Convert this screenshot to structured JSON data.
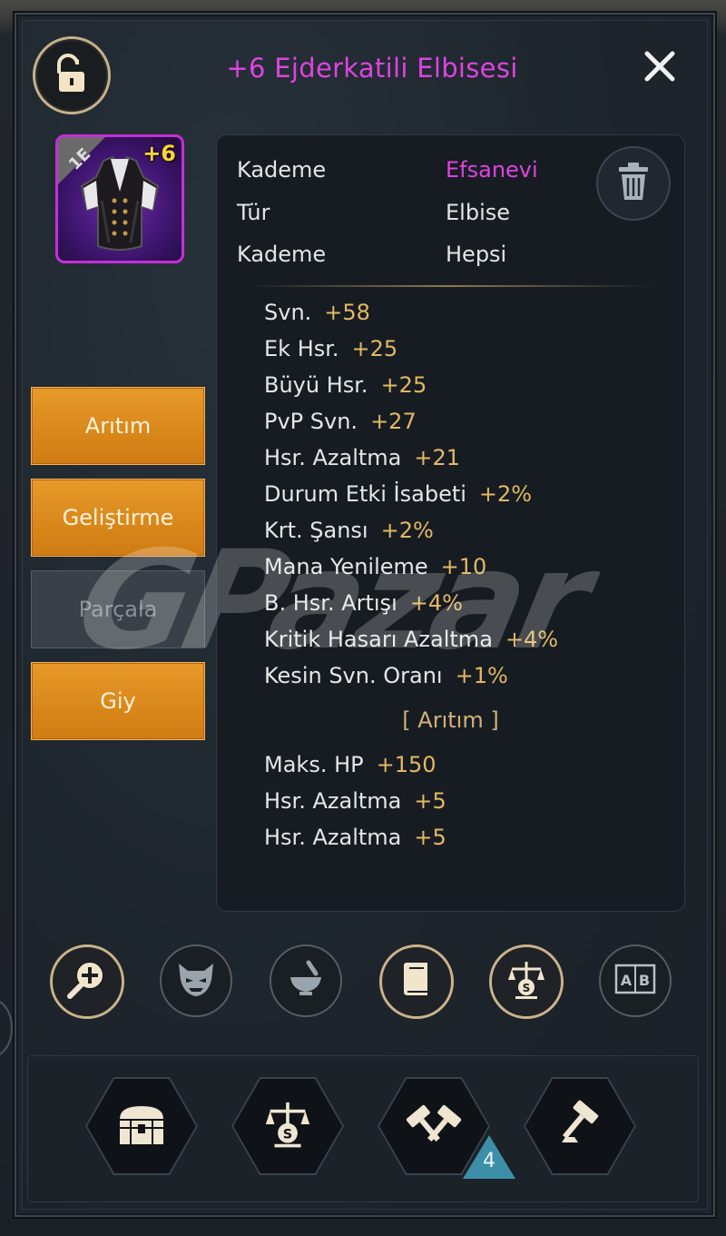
{
  "header": {
    "title": "+6 Ejderkatili Elbisesi"
  },
  "item": {
    "tier_badge": "1E",
    "enhance_level": "+6"
  },
  "side_buttons": {
    "refine": "Arıtım",
    "upgrade": "Geliştirme",
    "dismantle": "Parçala",
    "equip": "Giy"
  },
  "info": {
    "rows": [
      {
        "label": "Kademe",
        "value": "Efsanevi"
      },
      {
        "label": "Tür",
        "value": "Elbise"
      },
      {
        "label": "Kademe",
        "value": "Hepsi"
      }
    ],
    "stats": [
      {
        "name": "Svn.",
        "value": "+58"
      },
      {
        "name": "Ek Hsr.",
        "value": "+25"
      },
      {
        "name": "Büyü Hsr.",
        "value": "+25"
      },
      {
        "name": "PvP Svn.",
        "value": "+27"
      },
      {
        "name": "Hsr. Azaltma",
        "value": "+21"
      },
      {
        "name": "Durum Etki İsabeti",
        "value": "+2%"
      },
      {
        "name": "Krt. Şansı",
        "value": "+2%"
      },
      {
        "name": "Mana Yenileme",
        "value": "+10"
      },
      {
        "name": "B. Hsr. Artışı",
        "value": "+4%"
      },
      {
        "name": "Kritik Hasarı Azaltma",
        "value": "+4%"
      },
      {
        "name": "Kesin Svn. Oranı",
        "value": "+1%"
      }
    ],
    "refine_header": "[ Arıtım ]",
    "refine_stats": [
      {
        "name": "Maks. HP",
        "value": "+150"
      },
      {
        "name": "Hsr. Azaltma",
        "value": "+5"
      },
      {
        "name": "Hsr. Azaltma",
        "value": "+5"
      }
    ]
  },
  "watermark": "GPazar",
  "action_icons": [
    "magnify-plus-icon",
    "demon-mask-icon",
    "mortar-icon",
    "book-icon",
    "scales-icon",
    "ab-compare-icon"
  ],
  "bottom_icons": [
    "chest-icon",
    "scales-icon",
    "double-hammer-icon",
    "hammer-icon"
  ],
  "bottom_badge_count": "4",
  "colors": {
    "title": "#dd44e0",
    "legendary": "#dd44e0",
    "stat_value": "#e3b862",
    "button_orange": "#e0901f",
    "badge_blue": "#3d8fa8"
  }
}
